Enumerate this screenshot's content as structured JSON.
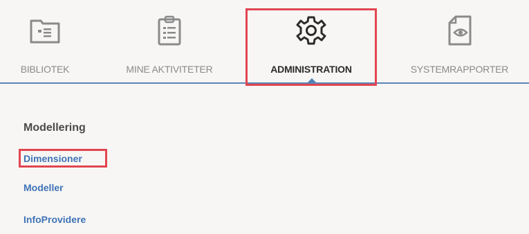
{
  "tabs": [
    {
      "label": "BIBLIOTEK",
      "icon": "library-folder-icon",
      "active": false
    },
    {
      "label": "MINE AKTIVITETER",
      "icon": "clipboard-list-icon",
      "active": false
    },
    {
      "label": "ADMINISTRATION",
      "icon": "gear-icon",
      "active": true
    },
    {
      "label": "SYSTEMRAPPORTER",
      "icon": "document-eye-icon",
      "active": false
    }
  ],
  "section": {
    "title": "Modellering",
    "links": [
      "Dimensioner",
      "Modeller",
      "InfoProvidere"
    ]
  },
  "colors": {
    "background": "#f7f6f4",
    "link": "#3f73b6",
    "highlight": "#e24550",
    "tab_underline": "#5a86b8",
    "icon_gray": "#8a8a8a"
  }
}
